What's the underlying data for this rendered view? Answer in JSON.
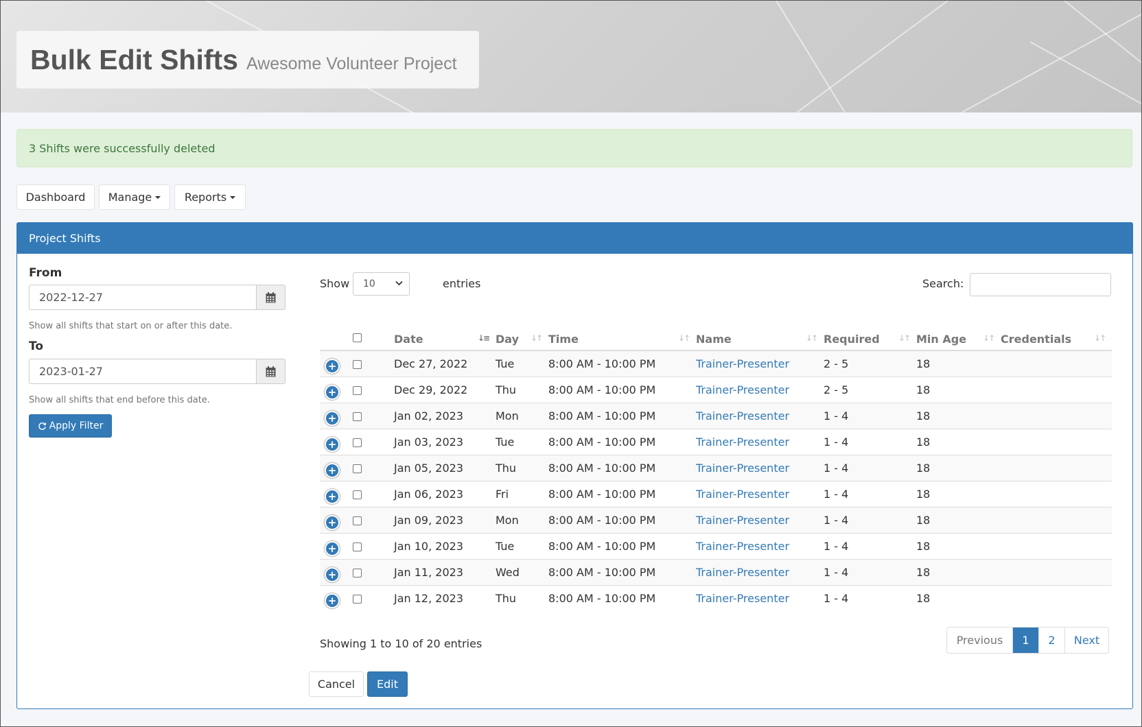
{
  "header": {
    "title": "Bulk Edit Shifts",
    "subtitle": "Awesome Volunteer Project"
  },
  "alert": {
    "message": "3 Shifts were successfully deleted"
  },
  "nav": {
    "dashboard_label": "Dashboard",
    "manage_label": "Manage",
    "reports_label": "Reports"
  },
  "panel": {
    "title": "Project Shifts"
  },
  "filter": {
    "from_label": "From",
    "from_value": "2022-12-27",
    "from_help": "Show all shifts that start on or after this date.",
    "to_label": "To",
    "to_value": "2023-01-27",
    "to_help": "Show all shifts that end before this date.",
    "apply_label": "Apply Filter"
  },
  "table_controls": {
    "show_label": "Show",
    "page_length": "10",
    "entries_label": "entries",
    "search_label": "Search:"
  },
  "table": {
    "columns": [
      "Date",
      "Day",
      "Time",
      "Name",
      "Required",
      "Min Age",
      "Credentials"
    ],
    "rows": [
      {
        "date": "Dec 27, 2022",
        "day": "Tue",
        "time": "8:00 AM - 10:00 PM",
        "name": "Trainer-Presenter",
        "required": "2 - 5",
        "min_age": "18",
        "credentials": ""
      },
      {
        "date": "Dec 29, 2022",
        "day": "Thu",
        "time": "8:00 AM - 10:00 PM",
        "name": "Trainer-Presenter",
        "required": "2 - 5",
        "min_age": "18",
        "credentials": ""
      },
      {
        "date": "Jan 02, 2023",
        "day": "Mon",
        "time": "8:00 AM - 10:00 PM",
        "name": "Trainer-Presenter",
        "required": "1 - 4",
        "min_age": "18",
        "credentials": ""
      },
      {
        "date": "Jan 03, 2023",
        "day": "Tue",
        "time": "8:00 AM - 10:00 PM",
        "name": "Trainer-Presenter",
        "required": "1 - 4",
        "min_age": "18",
        "credentials": ""
      },
      {
        "date": "Jan 05, 2023",
        "day": "Thu",
        "time": "8:00 AM - 10:00 PM",
        "name": "Trainer-Presenter",
        "required": "1 - 4",
        "min_age": "18",
        "credentials": ""
      },
      {
        "date": "Jan 06, 2023",
        "day": "Fri",
        "time": "8:00 AM - 10:00 PM",
        "name": "Trainer-Presenter",
        "required": "1 - 4",
        "min_age": "18",
        "credentials": ""
      },
      {
        "date": "Jan 09, 2023",
        "day": "Mon",
        "time": "8:00 AM - 10:00 PM",
        "name": "Trainer-Presenter",
        "required": "1 - 4",
        "min_age": "18",
        "credentials": ""
      },
      {
        "date": "Jan 10, 2023",
        "day": "Tue",
        "time": "8:00 AM - 10:00 PM",
        "name": "Trainer-Presenter",
        "required": "1 - 4",
        "min_age": "18",
        "credentials": ""
      },
      {
        "date": "Jan 11, 2023",
        "day": "Wed",
        "time": "8:00 AM - 10:00 PM",
        "name": "Trainer-Presenter",
        "required": "1 - 4",
        "min_age": "18",
        "credentials": ""
      },
      {
        "date": "Jan 12, 2023",
        "day": "Thu",
        "time": "8:00 AM - 10:00 PM",
        "name": "Trainer-Presenter",
        "required": "1 - 4",
        "min_age": "18",
        "credentials": ""
      }
    ]
  },
  "footer": {
    "info": "Showing 1 to 10 of 20 entries",
    "pager_previous": "Previous",
    "pager_pages": [
      "1",
      "2"
    ],
    "pager_next": "Next",
    "cancel_label": "Cancel",
    "edit_label": "Edit"
  },
  "colors": {
    "primary": "#337ab7",
    "alert_bg": "#dff0d8",
    "alert_text": "#3c763d"
  }
}
